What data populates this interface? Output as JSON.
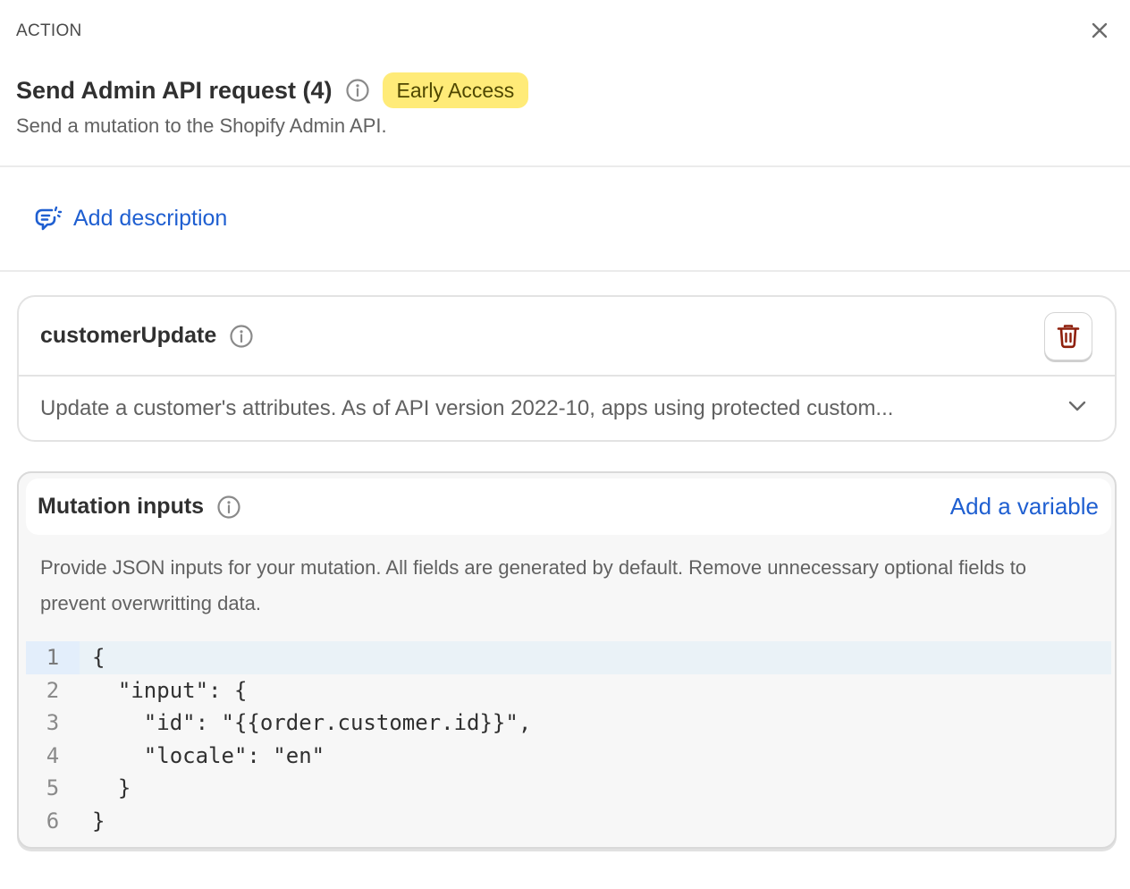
{
  "header": {
    "eyebrow": "ACTION",
    "title": "Send Admin API request (4)",
    "badge": "Early Access",
    "subtitle": "Send a mutation to the Shopify Admin API.",
    "close_icon": "close-icon"
  },
  "description": {
    "add_label": "Add description",
    "icon": "comment-add-icon"
  },
  "mutation_card": {
    "title": "customerUpdate",
    "description": "Update a customer's attributes. As of API version 2022-10, apps using protected custom...",
    "delete_icon": "trash-icon",
    "expand_icon": "chevron-down-icon"
  },
  "mutation_inputs": {
    "title": "Mutation inputs",
    "add_variable_label": "Add a variable",
    "help_text": "Provide JSON inputs for your mutation. All fields are generated by default. Remove unnecessary optional fields to prevent overwritting data.",
    "code_lines": [
      {
        "number": "1",
        "text": "{"
      },
      {
        "number": "2",
        "text": "  \"input\": {"
      },
      {
        "number": "3",
        "text": "    \"id\": \"{{order.customer.id}}\","
      },
      {
        "number": "4",
        "text": "    \"locale\": \"en\""
      },
      {
        "number": "5",
        "text": "  }"
      },
      {
        "number": "6",
        "text": "}"
      }
    ],
    "active_line": 1
  },
  "colors": {
    "link": "#1f5fd1",
    "badge_bg": "#ffeb78",
    "delete_icon": "#8e1f0b"
  }
}
